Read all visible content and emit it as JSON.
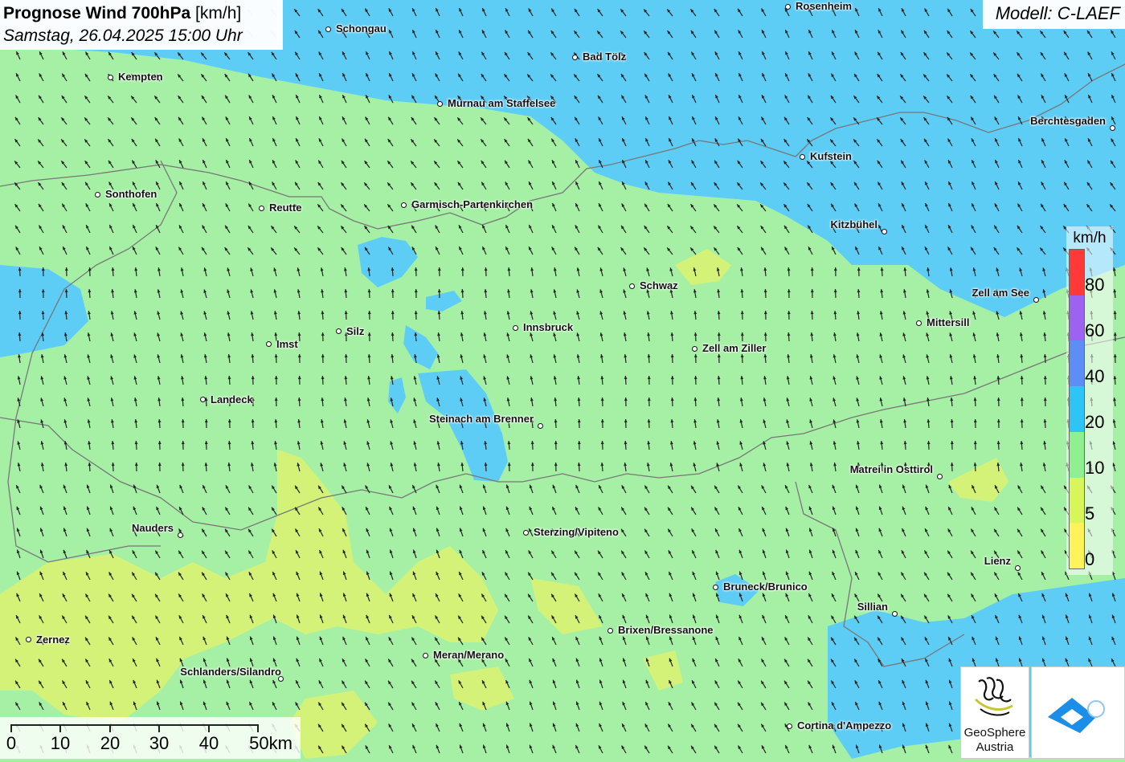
{
  "title": {
    "main": "Prognose Wind 700hPa",
    "unit": "[km/h]",
    "date": "Samstag, 26.04.2025 15:00 Uhr"
  },
  "model": "Modell: C-LAEF",
  "legend": {
    "unit": "km/h",
    "labels": [
      "80",
      "60",
      "40",
      "20",
      "10",
      "5",
      "0"
    ],
    "classes": [
      {
        "color": "#ff3838"
      },
      {
        "color": "#9b63f0"
      },
      {
        "color": "#5c8ef5"
      },
      {
        "color": "#2ec4f5"
      },
      {
        "color": "#8ef08e"
      },
      {
        "color": "#d8f55a"
      },
      {
        "color": "#fff35a"
      }
    ]
  },
  "scalebar": {
    "labels": [
      "0",
      "10",
      "20",
      "30",
      "40",
      "50km"
    ]
  },
  "logos": {
    "geosphere_line1": "GeoSphere",
    "geosphere_line2": "Austria"
  },
  "cities": [
    "Rosenheim",
    "Schongau",
    "Bad Tölz",
    "Kempten",
    "Murnau am Staffelsee",
    "Berchtesgaden",
    "Kufstein",
    "Sonthofen",
    "Reutte",
    "Garmisch-Partenkirchen",
    "Kitzbühel",
    "Schwaz",
    "Zell am See",
    "Mittersill",
    "Innsbruck",
    "Silz",
    "Imst",
    "Zell am Ziller",
    "Landeck",
    "Steinach am Brenner",
    "Matrei in Osttirol",
    "Nauders",
    "Sterzing/Vipiteno",
    "Lienz",
    "Bruneck/Brunico",
    "Sillian",
    "Brixen/Bressanone",
    "Zernez",
    "Meran/Merano",
    "Schlanders/Silandro",
    "Cortina d'Ampezzo"
  ]
}
